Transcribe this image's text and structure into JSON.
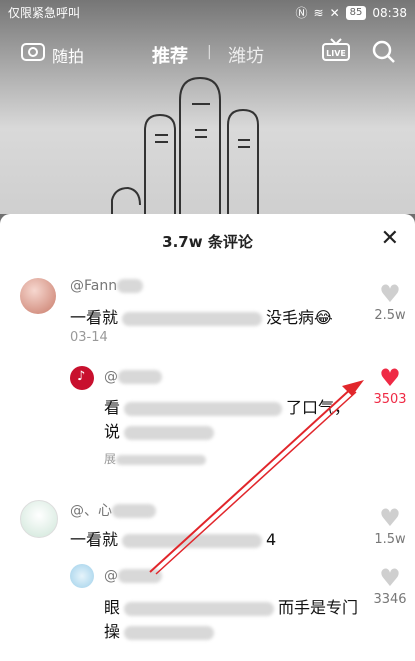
{
  "status": {
    "left_text": "仅限紧急呼叫",
    "battery": "85",
    "time": "08:38"
  },
  "topbar": {
    "camera_label": "随拍",
    "tab_recommend": "推荐",
    "tab_local": "潍坊",
    "live_label": "LIVE"
  },
  "sheet": {
    "title": "3.7w 条评论"
  },
  "comments": [
    {
      "user": "@Fann",
      "text_start": "一看就",
      "text_end": "没毛病",
      "emoji": "😂",
      "date": "03-14",
      "likes": "2.5w"
    },
    {
      "user": "@",
      "text_start": "看",
      "text_mid": "了口气，",
      "text_line2": "说",
      "expand": "展",
      "likes": "3503"
    },
    {
      "user": "@、心",
      "text_start": "一看就",
      "text_end": "4",
      "likes": "1.5w"
    },
    {
      "user": "@",
      "text_start": "眼",
      "text_mid": "而手是专门",
      "text_line2": "操",
      "likes": "3346"
    }
  ],
  "colors": {
    "like_active": "#ef2a45",
    "sheet_bg": "#ffffff"
  }
}
